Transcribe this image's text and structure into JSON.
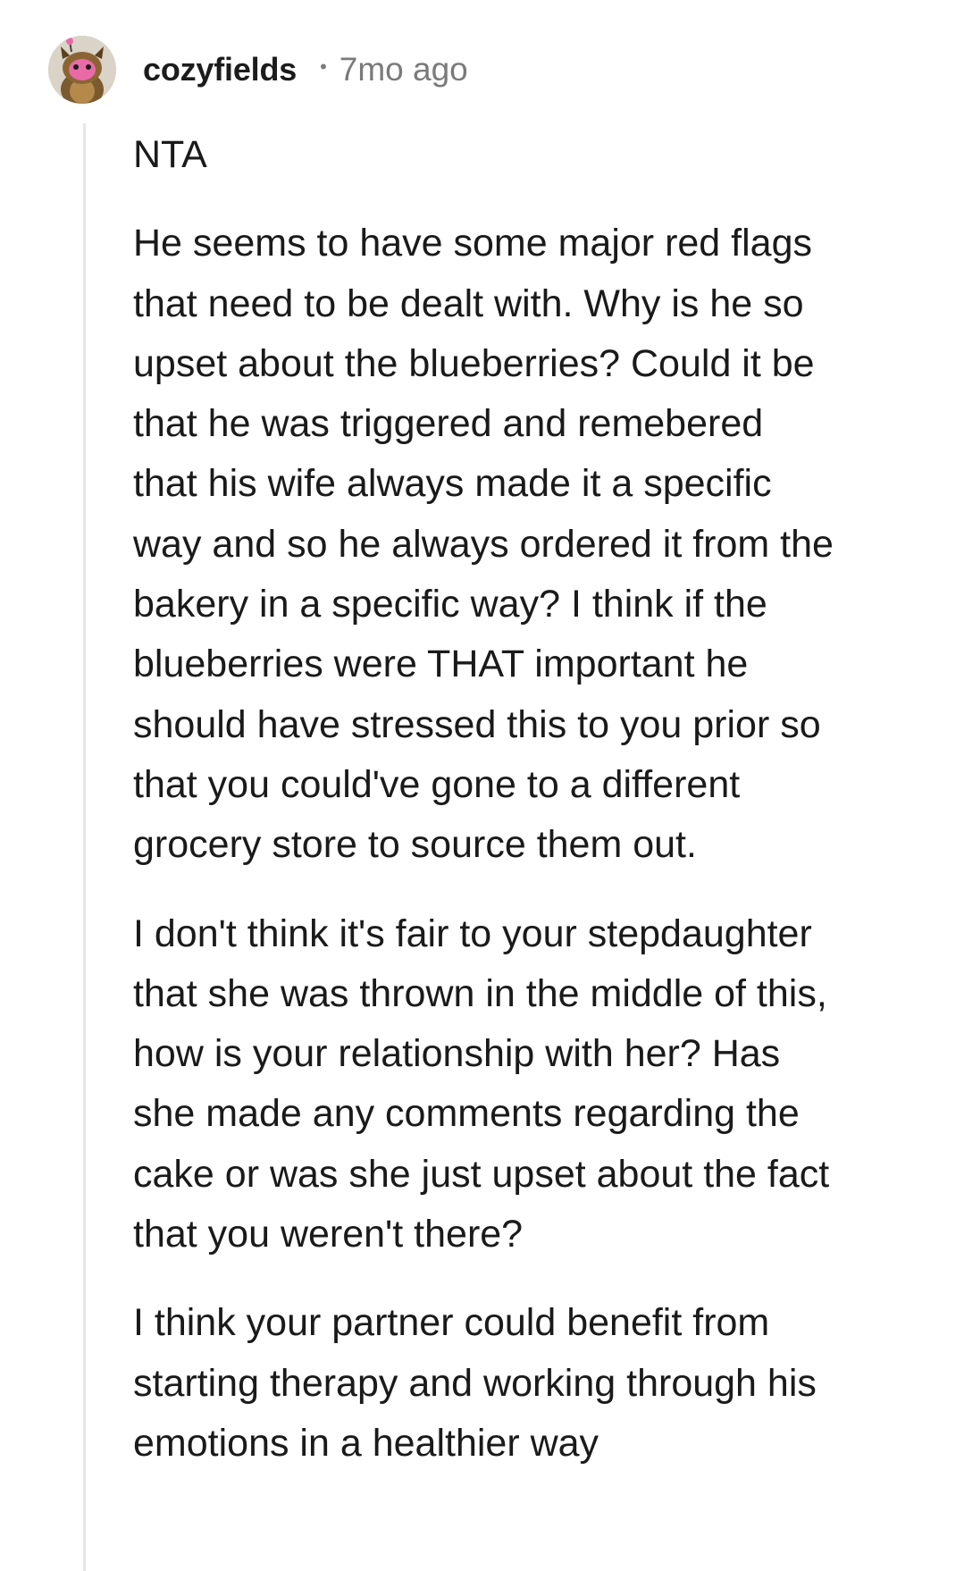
{
  "comment": {
    "author": "cozyfields",
    "separator": "•",
    "timestamp": "7mo ago",
    "avatar_icon": "snoo-avatar-icon",
    "paragraphs": [
      "NTA",
      "He seems to have some major red flags\nthat need to be dealt with. Why is he so\nupset about the blueberries? Could it be\nthat he was triggered and remebered\nthat his wife always made it a specific\nway and so he always ordered it from the\nbakery in a specific way? I think if the\nblueberries were THAT important he\nshould have stressed this to you prior so\nthat you could've gone to a different\ngrocery store to source them out.",
      "I don't think it's fair to your stepdaughter\nthat she was thrown in the middle of this,\nhow is your relationship with her? Has\nshe made any comments regarding the\ncake or was she just upset about the fact\nthat you weren't there?",
      "I think your partner could benefit from\nstarting therapy and working through his\nemotions in a healthier way"
    ]
  },
  "colors": {
    "background": "#ffffff",
    "text": "#1a1a1a",
    "meta": "#7a7a7a",
    "thread_line": "#e6e6e6"
  }
}
